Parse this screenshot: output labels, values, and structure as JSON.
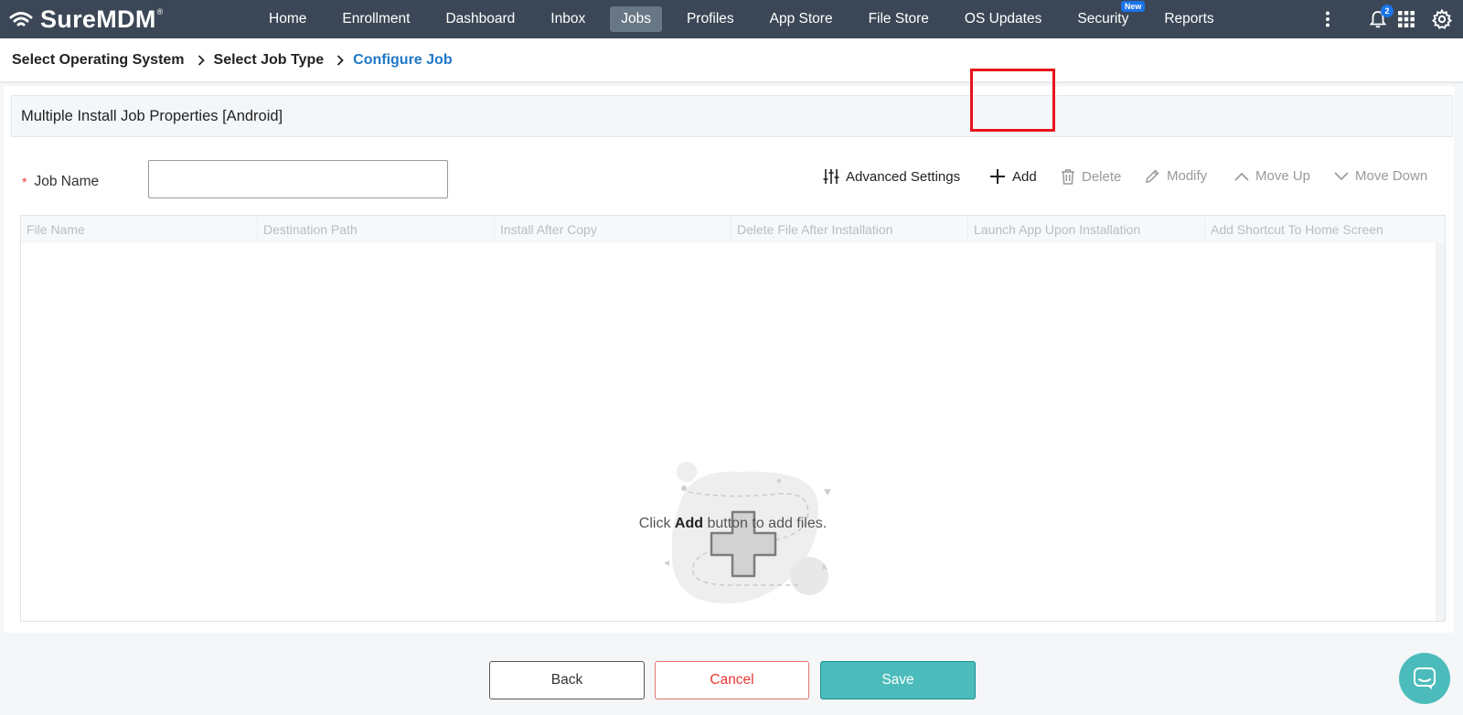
{
  "app": {
    "logo_text": "SureMDM",
    "logo_mark": "®"
  },
  "nav": {
    "items": [
      {
        "label": "Home"
      },
      {
        "label": "Enrollment"
      },
      {
        "label": "Dashboard"
      },
      {
        "label": "Inbox"
      },
      {
        "label": "Jobs",
        "active": true
      },
      {
        "label": "Profiles"
      },
      {
        "label": "App Store"
      },
      {
        "label": "File Store"
      },
      {
        "label": "OS Updates"
      },
      {
        "label": "Security",
        "badge": "New"
      },
      {
        "label": "Reports"
      }
    ],
    "notification_count": "2",
    "icons": [
      "more-vertical-icon",
      "bell-icon",
      "apps-grid-icon",
      "gear-icon"
    ]
  },
  "breadcrumb": {
    "steps": [
      "Select Operating System",
      "Select Job Type",
      "Configure Job"
    ]
  },
  "panel": {
    "title": "Multiple Install Job Properties [Android]",
    "job_name_label": "Job Name",
    "job_name_value": ""
  },
  "toolbar": {
    "advanced_settings": "Advanced Settings",
    "add": "Add",
    "delete": "Delete",
    "modify": "Modify",
    "move_up": "Move Up",
    "move_down": "Move Down"
  },
  "table": {
    "columns": [
      "File Name",
      "Destination Path",
      "Install After Copy",
      "Delete File After Installation",
      "Launch App Upon Installation",
      "Add Shortcut To Home Screen"
    ],
    "empty_prefix": "Click ",
    "empty_bold": "Add",
    "empty_suffix": " button to add files."
  },
  "footer": {
    "back": "Back",
    "cancel": "Cancel",
    "save": "Save"
  },
  "colors": {
    "topbar": "#3b4756",
    "accent_teal": "#4bbcbb",
    "link_blue": "#1f77c6",
    "highlight_red": "#e8131b"
  }
}
